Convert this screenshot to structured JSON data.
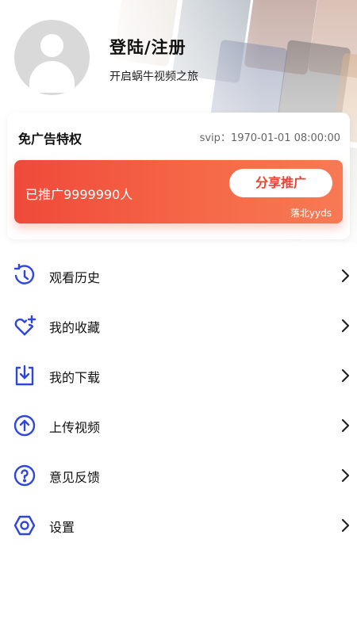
{
  "profile": {
    "title": "登陆/注册",
    "subtitle": "开启蜗牛视频之旅",
    "avatar_icon": "default-user-avatar"
  },
  "vip_card": {
    "title": "免广告特权",
    "expire": "svip：1970-01-01 08:00:00",
    "promo": {
      "count_text": "已推广9999990人",
      "share_label": "分享推广",
      "signature": "落北yyds"
    }
  },
  "menu": [
    {
      "label": "观看历史",
      "icon": "history-icon"
    },
    {
      "label": "我的收藏",
      "icon": "favorite-heart-icon"
    },
    {
      "label": "我的下载",
      "icon": "download-icon"
    },
    {
      "label": "上传视频",
      "icon": "upload-icon"
    },
    {
      "label": "意见反馈",
      "icon": "feedback-question-icon"
    },
    {
      "label": "设置",
      "icon": "settings-icon"
    }
  ],
  "colors": {
    "accent_blue": "#2f45e0",
    "promo_red": "#f0493a",
    "share_text": "#ef3f30"
  }
}
